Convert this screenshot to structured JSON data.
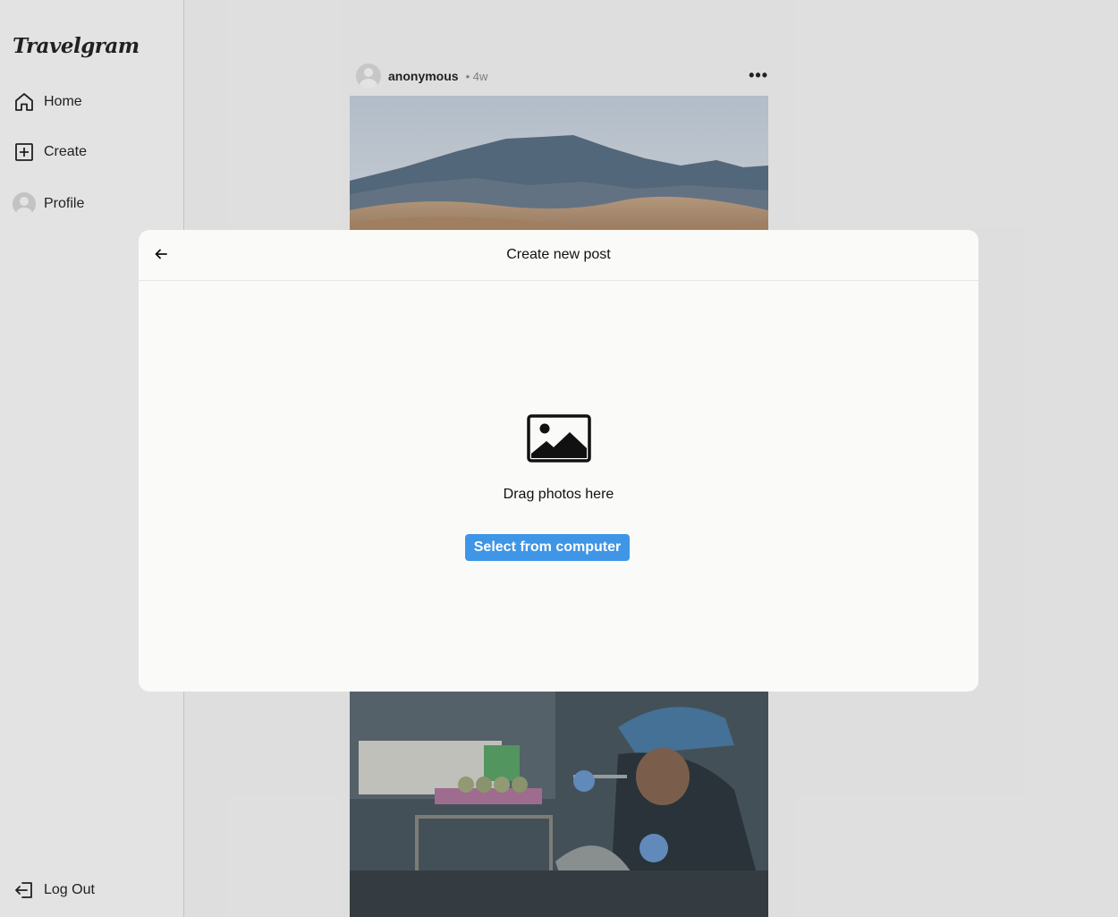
{
  "app": {
    "brand": "Travelgram"
  },
  "sidebar": {
    "items": [
      {
        "label": "Home",
        "icon": "home-icon"
      },
      {
        "label": "Create",
        "icon": "plus-square-icon"
      },
      {
        "label": "Profile",
        "icon": "avatar"
      }
    ],
    "logout": {
      "label": "Log Out",
      "icon": "logout-icon"
    }
  },
  "feed": {
    "post": {
      "username": "anonymous",
      "time": "• 4w",
      "more": "•••"
    }
  },
  "modal": {
    "title": "Create new post",
    "drag_text": "Drag photos here",
    "select_button": "Select from computer"
  },
  "colors": {
    "accent": "#3f95e6",
    "overlay": "rgba(0,0,0,0.11)"
  }
}
